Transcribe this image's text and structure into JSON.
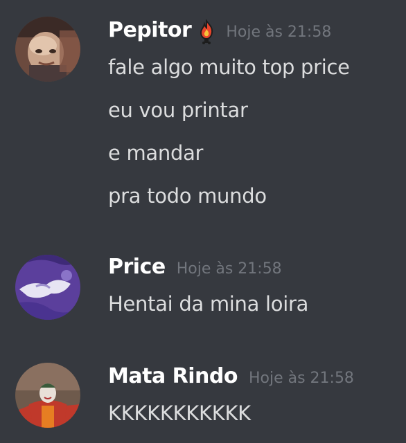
{
  "messages": [
    {
      "username": "Pepitor",
      "timestamp": "Hoje às 21:58",
      "badge_icon": "fire-badge-icon",
      "lines": [
        "fale algo muito top price",
        "eu vou printar",
        "e mandar",
        "pra todo mundo"
      ]
    },
    {
      "username": "Price",
      "timestamp": "Hoje às 21:58",
      "lines": [
        "Hentai da mina loira"
      ]
    },
    {
      "username": "Mata Rindo",
      "timestamp": "Hoje às 21:58",
      "lines": [
        "KKKKKKKKKKK"
      ]
    }
  ],
  "colors": {
    "background": "#36393f",
    "username": "#ffffff",
    "timestamp": "#72767d",
    "message_text": "#dcddde",
    "badge_flame": "#e8452c"
  }
}
